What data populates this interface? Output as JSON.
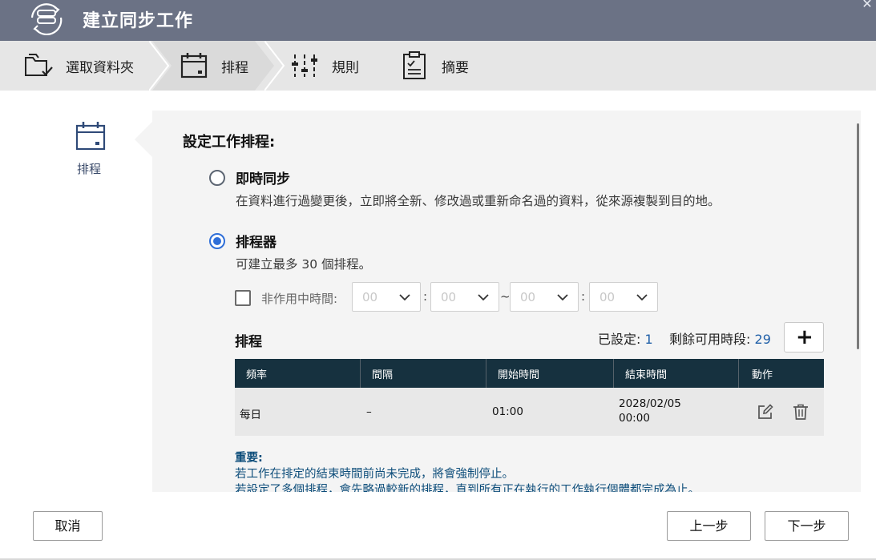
{
  "window": {
    "title": "建立同步工作",
    "close_glyph": "✕",
    "title_icon": "sync-drive-icon"
  },
  "stepper": {
    "steps": [
      {
        "label": "選取資料夾",
        "icon": "folder-check-icon"
      },
      {
        "label": "排程",
        "icon": "calendar-icon",
        "active": true
      },
      {
        "label": "規則",
        "icon": "sliders-icon"
      },
      {
        "label": "摘要",
        "icon": "clipboard-icon"
      }
    ]
  },
  "rail": {
    "label": "排程",
    "icon": "calendar-icon"
  },
  "schedule": {
    "heading": "設定工作排程:",
    "options": [
      {
        "title": "即時同步",
        "desc": "在資料進行過變更後，立即將全新、修改過或重新命名過的資料，從來源複製到目的地。",
        "selected": false
      },
      {
        "title": "排程器",
        "desc": "可建立最多 30 個排程。",
        "selected": true
      }
    ],
    "inactive": {
      "label": "非作用中時間:",
      "checked": false,
      "values": [
        "00",
        "00",
        "00",
        "00"
      ],
      "colon": ":",
      "tilde": "~"
    },
    "table_title": "排程",
    "stats": {
      "set_label": "已設定:",
      "set_value": "1",
      "remaining_label": "剩餘可用時段:",
      "remaining_value": "29"
    },
    "add_label": "+",
    "columns": [
      "頻率",
      "間隔",
      "開始時間",
      "結束時間",
      "動作"
    ],
    "rows": [
      {
        "frequency": "每日",
        "interval": "–",
        "start": "01:00",
        "end_date": "2028/02/05",
        "end_time": "00:00"
      }
    ],
    "important": {
      "heading": "重要:",
      "lines": [
        "若工作在排定的結束時間前尚未完成，將會強制停止。",
        "若設定了多個排程，會先略過較新的排程，直到所有正在執行的工作執行個體都完成為止。"
      ]
    }
  },
  "footer": {
    "cancel": "取消",
    "prev": "上一步",
    "next": "下一步"
  },
  "colors": {
    "titlebar": "#6b7285",
    "accent": "#2f6fd8",
    "table_header": "#16313f",
    "link_blue": "#1f5fa8"
  }
}
